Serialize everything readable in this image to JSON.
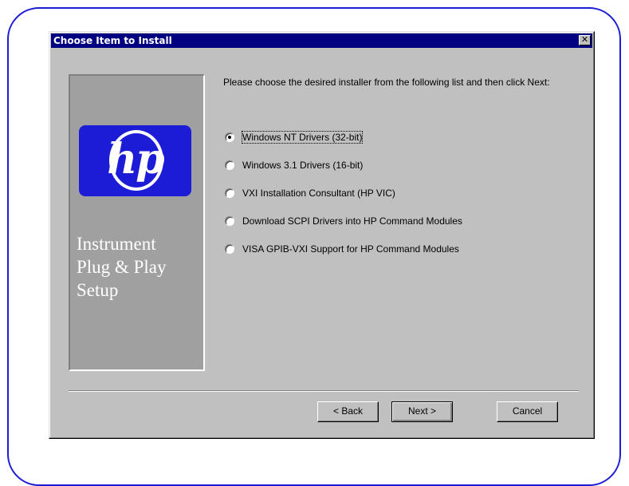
{
  "dialog": {
    "title": "Choose Item to Install",
    "close_label": "✕"
  },
  "sidebar": {
    "logo_text": "hp",
    "title_lines": [
      "Instrument",
      "Plug & Play",
      "Setup"
    ]
  },
  "main": {
    "instructions": "Please choose the desired installer from the following list and then click Next:",
    "options": [
      {
        "label": "Windows NT Drivers (32-bit)",
        "selected": true
      },
      {
        "label": "Windows 3.1 Drivers (16-bit)",
        "selected": false
      },
      {
        "label": "VXI Installation Consultant (HP VIC)",
        "selected": false
      },
      {
        "label": "Download SCPI Drivers into HP Command Modules",
        "selected": false
      },
      {
        "label": "VISA GPIB-VXI Support for HP Command Modules",
        "selected": false
      }
    ]
  },
  "buttons": {
    "back_label": "< Back",
    "next_label": "Next >",
    "cancel_label": "Cancel"
  },
  "colors": {
    "frame": "#1c1cd6",
    "titlebar": "#000080",
    "dialog_bg": "#c0c0c0",
    "logo_bg": "#1c1cd6"
  }
}
